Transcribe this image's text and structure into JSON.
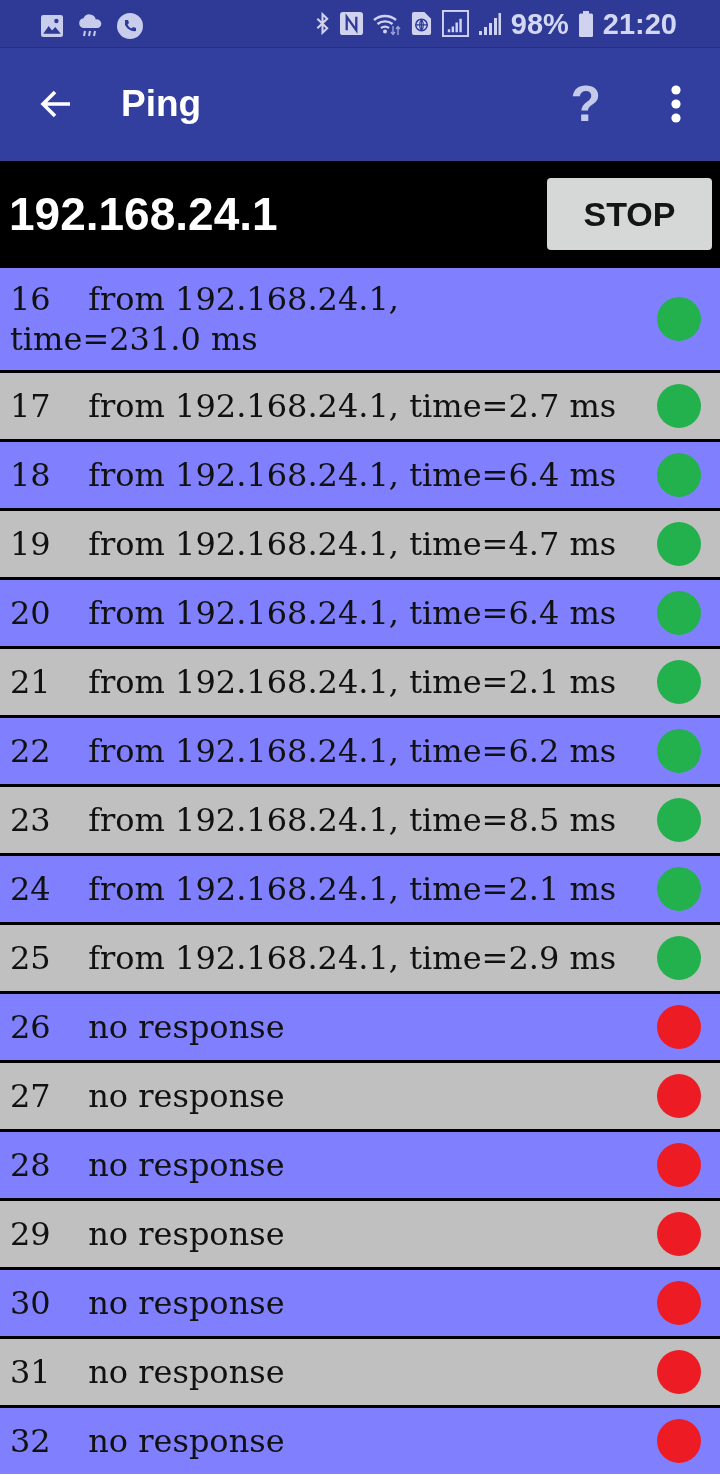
{
  "status_bar": {
    "battery": "98%",
    "time": "21:20"
  },
  "app_bar": {
    "title": "Ping",
    "help": "?"
  },
  "target": {
    "host": "192.168.24.1",
    "button": "STOP"
  },
  "replies": [
    {
      "seq": "16",
      "message": "from 192.168.24.1, time=231.0 ms",
      "color": "#22b14c"
    },
    {
      "seq": "17",
      "message": "from 192.168.24.1, time=2.7 ms",
      "color": "#22b14c"
    },
    {
      "seq": "18",
      "message": "from 192.168.24.1, time=6.4 ms",
      "color": "#22b14c"
    },
    {
      "seq": "19",
      "message": "from 192.168.24.1, time=4.7 ms",
      "color": "#22b14c"
    },
    {
      "seq": "20",
      "message": "from 192.168.24.1, time=6.4 ms",
      "color": "#22b14c"
    },
    {
      "seq": "21",
      "message": "from 192.168.24.1, time=2.1 ms",
      "color": "#22b14c"
    },
    {
      "seq": "22",
      "message": "from 192.168.24.1, time=6.2 ms",
      "color": "#22b14c"
    },
    {
      "seq": "23",
      "message": "from 192.168.24.1, time=8.5 ms",
      "color": "#22b14c"
    },
    {
      "seq": "24",
      "message": "from 192.168.24.1, time=2.1 ms",
      "color": "#22b14c"
    },
    {
      "seq": "25",
      "message": "from 192.168.24.1, time=2.9 ms",
      "color": "#22b14c"
    },
    {
      "seq": "26",
      "message": "no response",
      "color": "#ed1c24"
    },
    {
      "seq": "27",
      "message": "no response",
      "color": "#ed1c24"
    },
    {
      "seq": "28",
      "message": "no response",
      "color": "#ed1c24"
    },
    {
      "seq": "29",
      "message": "no response",
      "color": "#ed1c24"
    },
    {
      "seq": "30",
      "message": "no response",
      "color": "#ed1c24"
    },
    {
      "seq": "31",
      "message": "no response",
      "color": "#ed1c24"
    },
    {
      "seq": "32",
      "message": "no response",
      "color": "#ed1c24"
    }
  ]
}
